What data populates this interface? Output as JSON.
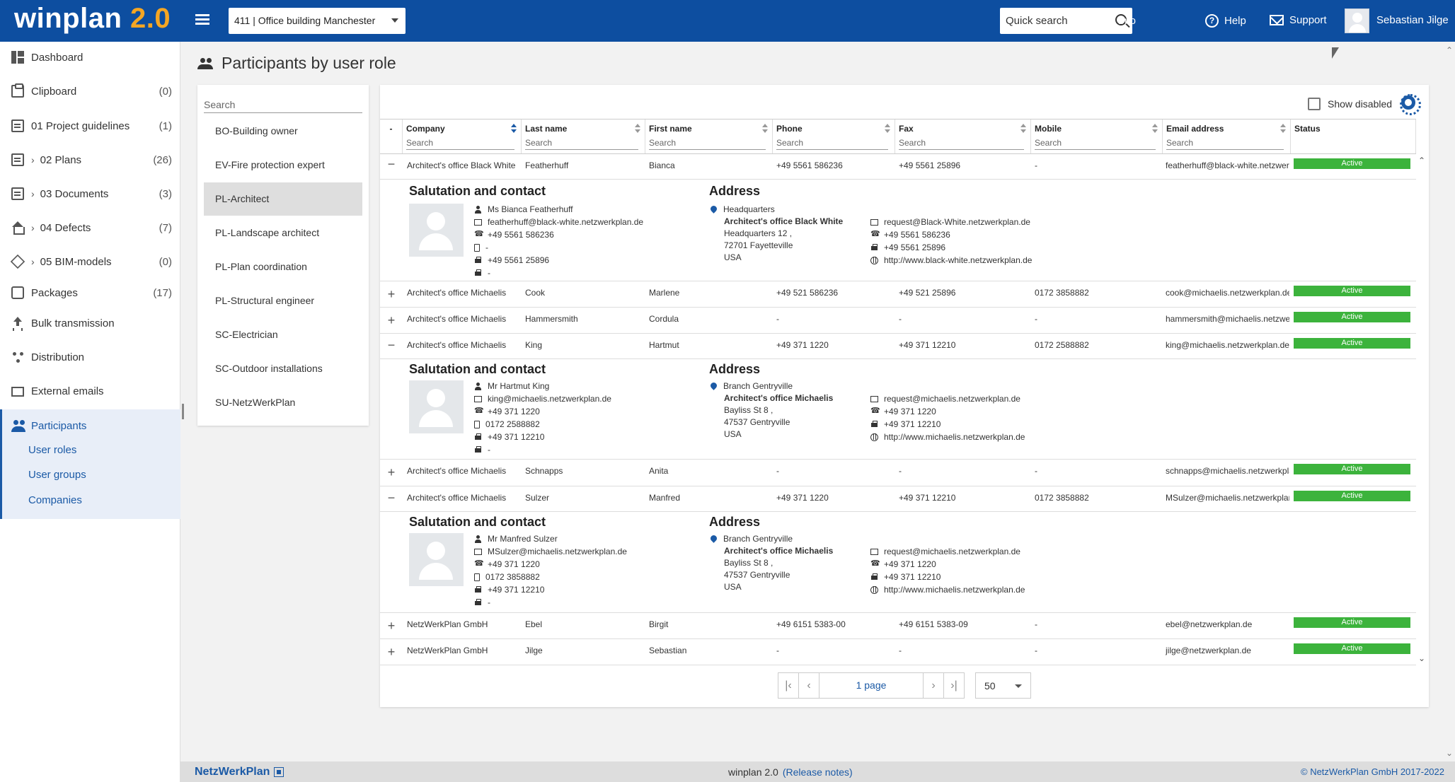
{
  "app": {
    "logo_text": "winplan",
    "logo_version": "2.0"
  },
  "topbar": {
    "project": "411 | Office building Manchester",
    "quick_search_placeholder": "Quick search",
    "info": "Info",
    "help": "Help",
    "support": "Support",
    "user_name": "Sebastian Jilge"
  },
  "sidebar": {
    "items": [
      {
        "label": "Dashboard",
        "count": ""
      },
      {
        "label": "Clipboard",
        "count": "(0)"
      },
      {
        "label": "01 Project guidelines",
        "count": "(1)"
      },
      {
        "label": "02 Plans",
        "count": "(26)"
      },
      {
        "label": "03 Documents",
        "count": "(3)"
      },
      {
        "label": "04 Defects",
        "count": "(7)"
      },
      {
        "label": "05 BIM-models",
        "count": "(0)"
      },
      {
        "label": "Packages",
        "count": "(17)"
      },
      {
        "label": "Bulk transmission",
        "count": ""
      },
      {
        "label": "Distribution",
        "count": ""
      },
      {
        "label": "External emails",
        "count": ""
      },
      {
        "label": "Participants",
        "count": ""
      }
    ],
    "subitems": [
      "User roles",
      "User groups",
      "Companies"
    ]
  },
  "page": {
    "title": "Participants by user role"
  },
  "roles": {
    "search_placeholder": "Search",
    "items": [
      "BO-Building owner",
      "EV-Fire protection expert",
      "PL-Architect",
      "PL-Landscape architect",
      "PL-Plan coordination",
      "PL-Structural engineer",
      "SC-Electrician",
      "SC-Outdoor installations",
      "SU-NetzWerkPlan"
    ],
    "active": "PL-Architect"
  },
  "table": {
    "show_disabled": "Show disabled",
    "search_placeholder": "Search",
    "columns": [
      "Company",
      "Last name",
      "First name",
      "Phone",
      "Fax",
      "Mobile",
      "Email address",
      "Status"
    ],
    "rows": [
      {
        "toggle": "−",
        "company": "Architect's office Black White",
        "last": "Featherhuff",
        "first": "Bianca",
        "phone": "+49 5561 586236",
        "fax": "+49 5561 25896",
        "mobile": "-",
        "email": "featherhuff@black-white.netzwerkplan.de",
        "status": "Active"
      },
      {
        "toggle": "+",
        "company": "Architect's office Michaelis",
        "last": "Cook",
        "first": "Marlene",
        "phone": "+49 521 586236",
        "fax": "+49 521 25896",
        "mobile": "0172 3858882",
        "email": "cook@michaelis.netzwerkplan.de",
        "status": "Active"
      },
      {
        "toggle": "+",
        "company": "Architect's office Michaelis",
        "last": "Hammersmith",
        "first": "Cordula",
        "phone": "-",
        "fax": "-",
        "mobile": "-",
        "email": "hammersmith@michaelis.netzwerkplan.de",
        "status": "Active"
      },
      {
        "toggle": "−",
        "company": "Architect's office Michaelis",
        "last": "King",
        "first": "Hartmut",
        "phone": "+49 371 1220",
        "fax": "+49 371 12210",
        "mobile": "0172 2588882",
        "email": "king@michaelis.netzwerkplan.de",
        "status": "Active"
      },
      {
        "toggle": "+",
        "company": "Architect's office Michaelis",
        "last": "Schnapps",
        "first": "Anita",
        "phone": "-",
        "fax": "-",
        "mobile": "-",
        "email": "schnapps@michaelis.netzwerkplan.de",
        "status": "Active"
      },
      {
        "toggle": "−",
        "company": "Architect's office Michaelis",
        "last": "Sulzer",
        "first": "Manfred",
        "phone": "+49 371 1220",
        "fax": "+49 371 12210",
        "mobile": "0172 3858882",
        "email": "MSulzer@michaelis.netzwerkplan.de",
        "status": "Active"
      },
      {
        "toggle": "+",
        "company": "NetzWerkPlan GmbH",
        "last": "Ebel",
        "first": "Birgit",
        "phone": "+49 6151 5383-00",
        "fax": "+49 6151 5383-09",
        "mobile": "-",
        "email": "ebel@netzwerkplan.de",
        "status": "Active"
      },
      {
        "toggle": "+",
        "company": "NetzWerkPlan GmbH",
        "last": "Jilge",
        "first": "Sebastian",
        "phone": "-",
        "fax": "-",
        "mobile": "-",
        "email": "jilge@netzwerkplan.de",
        "status": "Active"
      }
    ],
    "details": [
      {
        "salutation_title": "Salutation and contact",
        "address_title": "Address",
        "name": "Ms Bianca Featherhuff",
        "email": "featherhuff@black-white.netzwerkplan.de",
        "phone": "+49 5561 586236",
        "mobile": "-",
        "fax": "+49 5561 25896",
        "other": "-",
        "addr_type": "Headquarters",
        "addr_company": "Architect's office Black White",
        "addr_street": "Headquarters 12 ,",
        "addr_city": "72701 Fayetteville",
        "addr_country": "USA",
        "c_email": "request@Black-White.netzwerkplan.de",
        "c_phone": "+49 5561 586236",
        "c_fax": "+49 5561 25896",
        "c_web": "http://www.black-white.netzwerkplan.de"
      },
      {
        "salutation_title": "Salutation and contact",
        "address_title": "Address",
        "name": "Mr Hartmut King",
        "email": "king@michaelis.netzwerkplan.de",
        "phone": "+49 371 1220",
        "mobile": "0172 2588882",
        "fax": "+49 371 12210",
        "other": "-",
        "addr_type": "Branch Gentryville",
        "addr_company": "Architect's office Michaelis",
        "addr_street": "Bayliss St 8 ,",
        "addr_city": "47537 Gentryville",
        "addr_country": "USA",
        "c_email": "request@michaelis.netzwerkplan.de",
        "c_phone": "+49 371 1220",
        "c_fax": "+49 371 12210",
        "c_web": "http://www.michaelis.netzwerkplan.de"
      },
      {
        "salutation_title": "Salutation and contact",
        "address_title": "Address",
        "name": "Mr Manfred Sulzer",
        "email": "MSulzer@michaelis.netzwerkplan.de",
        "phone": "+49 371 1220",
        "mobile": "0172 3858882",
        "fax": "+49 371 12210",
        "other": "-",
        "addr_type": "Branch Gentryville",
        "addr_company": "Architect's office Michaelis",
        "addr_street": "Bayliss St 8 ,",
        "addr_city": "47537 Gentryville",
        "addr_country": "USA",
        "c_email": "request@michaelis.netzwerkplan.de",
        "c_phone": "+49 371 1220",
        "c_fax": "+49 371 12210",
        "c_web": "http://www.michaelis.netzwerkplan.de"
      }
    ]
  },
  "pager": {
    "first": "|‹",
    "prev": "‹",
    "page_label": "1 page",
    "next": "›",
    "last": "›|",
    "page_size": "50"
  },
  "footer": {
    "brand": "NetzWerkPlan",
    "product": "winplan 2.0",
    "release_notes": "(Release notes)",
    "copyright": "© NetzWerkPlan GmbH 2017-2022"
  },
  "colors": {
    "brand": "#0d4ea0",
    "accent": "#1b5aa6",
    "status_active": "#3cb33c",
    "logo_version": "#f5a623"
  }
}
